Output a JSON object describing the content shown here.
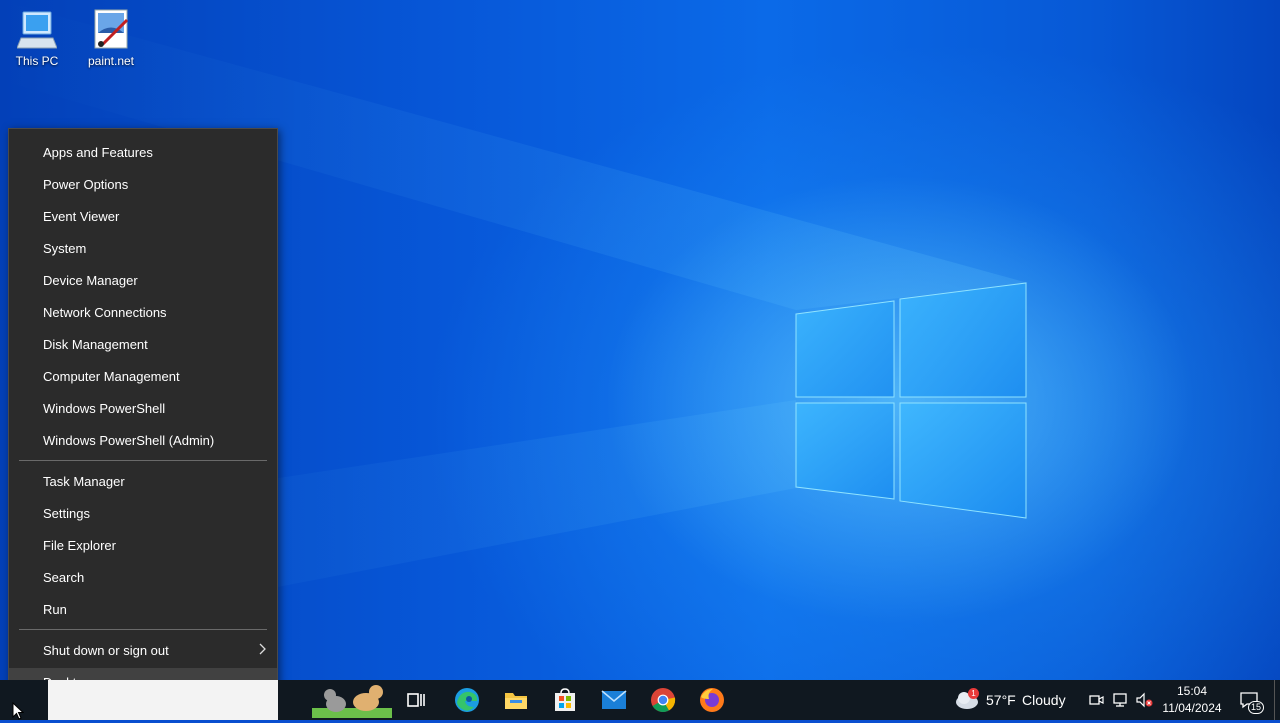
{
  "desktop": {
    "icons": [
      {
        "label": "This PC",
        "icon": "computer-icon"
      },
      {
        "label": "paint.net",
        "icon": "paintnet-icon"
      }
    ]
  },
  "winx_menu": {
    "groups": [
      [
        "Apps and Features",
        "Power Options",
        "Event Viewer",
        "System",
        "Device Manager",
        "Network Connections",
        "Disk Management",
        "Computer Management",
        "Windows PowerShell",
        "Windows PowerShell (Admin)"
      ],
      [
        "Task Manager",
        "Settings",
        "File Explorer",
        "Search",
        "Run"
      ],
      [
        "Shut down or sign out",
        "Desktop"
      ]
    ],
    "submenu_item": "Shut down or sign out",
    "highlighted_item": "Desktop"
  },
  "taskbar": {
    "apps": [
      {
        "name": "task-view",
        "icon": "task-view-icon"
      },
      {
        "name": "edge",
        "icon": "edge-icon"
      },
      {
        "name": "file-explorer",
        "icon": "folder-icon"
      },
      {
        "name": "store",
        "icon": "store-icon"
      },
      {
        "name": "mail",
        "icon": "mail-icon"
      },
      {
        "name": "chrome",
        "icon": "chrome-icon"
      },
      {
        "name": "firefox",
        "icon": "firefox-icon"
      }
    ],
    "weather": {
      "temp": "57°F",
      "condition": "Cloudy",
      "badge": "1"
    },
    "clock": {
      "time": "15:04",
      "date": "11/04/2024"
    },
    "notifications_count": "15"
  },
  "colors": {
    "menu_bg": "#2b2b2b",
    "menu_hover": "#414141",
    "taskbar_bg": "#101820",
    "desktop_blue": "#0757d8"
  }
}
